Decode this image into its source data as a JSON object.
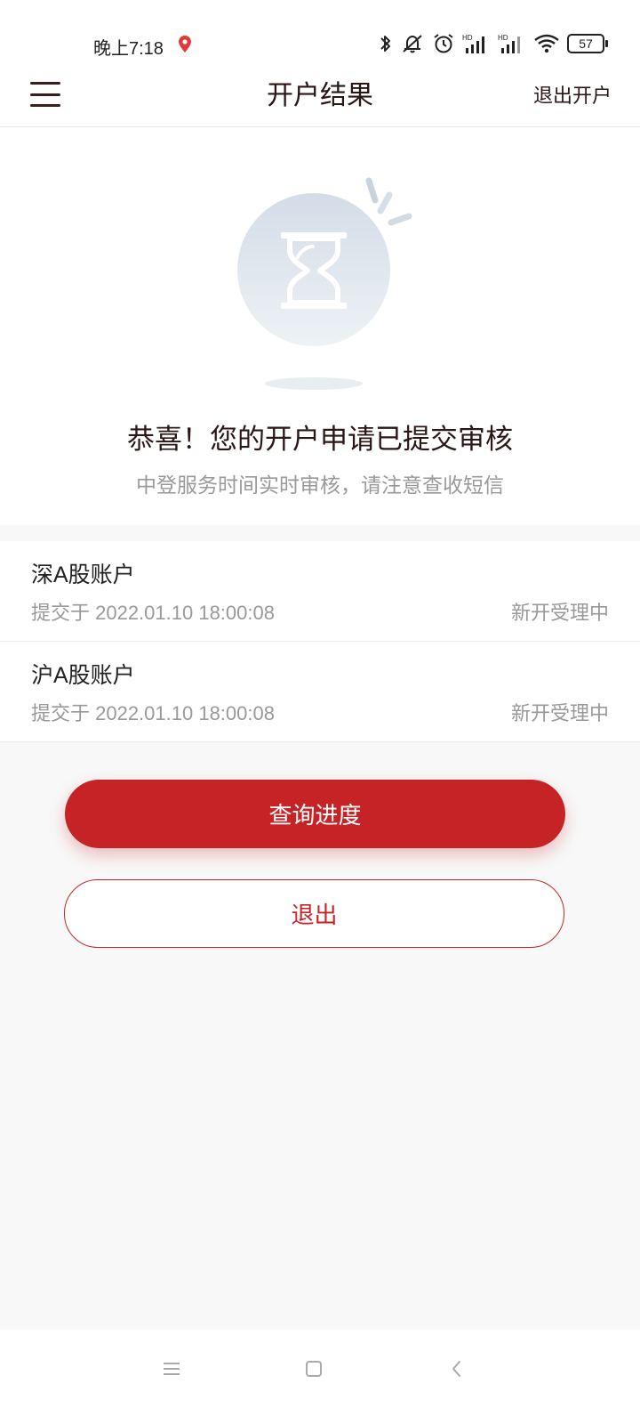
{
  "status_bar": {
    "time": "晚上7:18",
    "battery": "57",
    "icons": [
      "location-pin-icon",
      "bluetooth-icon",
      "mute-icon",
      "alarm-icon",
      "signal-hd-icon",
      "signal-hd-icon",
      "wifi-icon",
      "battery-icon"
    ]
  },
  "header": {
    "title": "开户结果",
    "exit_label": "退出开户",
    "menu_icon": "menu-icon"
  },
  "result": {
    "illustration": "hourglass-icon",
    "title": "恭喜！您的开户申请已提交审核",
    "subtitle": "中登服务时间实时审核，请注意查收短信"
  },
  "accounts": [
    {
      "name": "深A股账户",
      "submitted": "提交于 2022.01.10 18:00:08",
      "status": "新开受理中"
    },
    {
      "name": "沪A股账户",
      "submitted": "提交于 2022.01.10 18:00:08",
      "status": "新开受理中"
    }
  ],
  "actions": {
    "query_label": "查询进度",
    "exit_label": "退出"
  },
  "colors": {
    "accent": "#c62326",
    "title_text": "#2a1616",
    "muted_text": "#999999",
    "background": "#f8f8f8"
  },
  "system_nav": [
    "menu-lines-icon",
    "home-square-icon",
    "back-chevron-icon"
  ]
}
